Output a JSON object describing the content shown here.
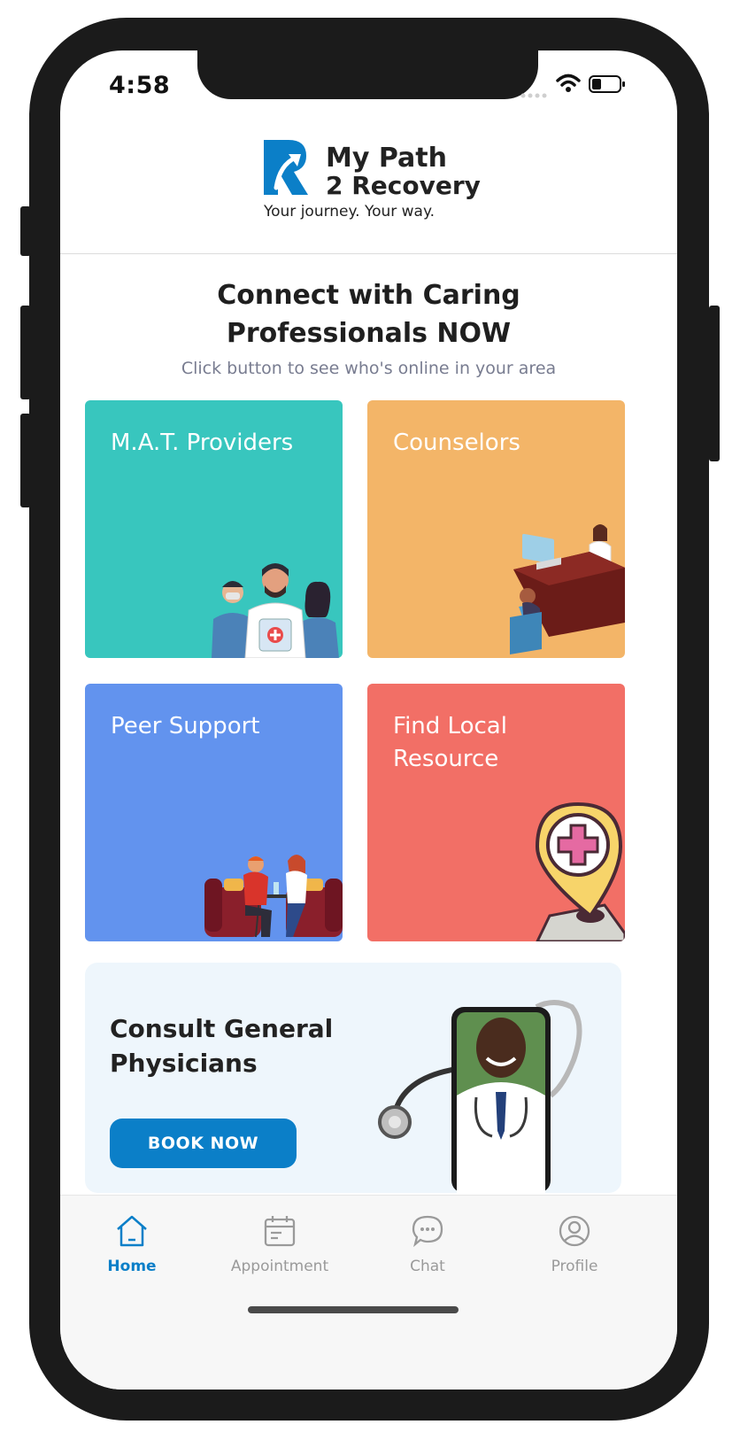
{
  "status_bar": {
    "time": "4:58"
  },
  "brand": {
    "line1": "My Path",
    "line2": "2 Recovery",
    "tagline": "Your journey. Your way."
  },
  "hero": {
    "title_line1": "Connect with Caring",
    "title_line2": "Professionals NOW",
    "subtitle": "Click button to see who's online  in your area"
  },
  "cards": [
    {
      "label": "M.A.T. Providers",
      "color": "#38c6be"
    },
    {
      "label": "Counselors",
      "color": "#f3b568"
    },
    {
      "label": "Peer Support",
      "color": "#6293ee"
    },
    {
      "label_line1": "Find Local",
      "label_line2": "Resource",
      "color": "#f26f66"
    }
  ],
  "consult": {
    "title_line1": "Consult General",
    "title_line2": "Physicians",
    "button": "BOOK NOW"
  },
  "tabbar": {
    "items": [
      {
        "label": "Home",
        "icon": "home-icon",
        "active": true
      },
      {
        "label": "Appointment",
        "icon": "calendar-icon"
      },
      {
        "label": "Chat",
        "icon": "chat-icon"
      },
      {
        "label": "Profile",
        "icon": "profile-icon"
      }
    ]
  },
  "colors": {
    "accent": "#0b7fc8",
    "brand": "#0b7fc8"
  }
}
